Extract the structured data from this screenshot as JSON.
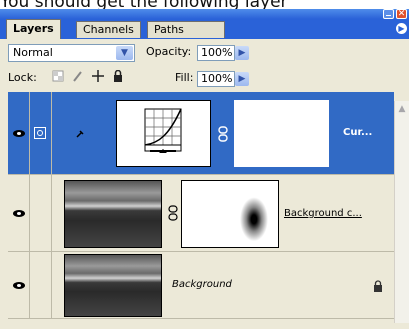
{
  "caption": "You should get the following layer",
  "tabs": [
    {
      "label": "Layers"
    },
    {
      "label": "Channels"
    },
    {
      "label": "Paths"
    }
  ],
  "blend_mode": "Normal",
  "opacity_label": "Opacity:",
  "opacity_value": "100%",
  "lock_label": "Lock:",
  "fill_label": "Fill:",
  "fill_value": "100%",
  "layers": [
    {
      "name": "Cur..."
    },
    {
      "name": "Background c..."
    },
    {
      "name": "Background"
    }
  ],
  "colors": {
    "accent": "#316ac5",
    "titlebar": "#2a62d8",
    "panel": "#ece9d8"
  }
}
